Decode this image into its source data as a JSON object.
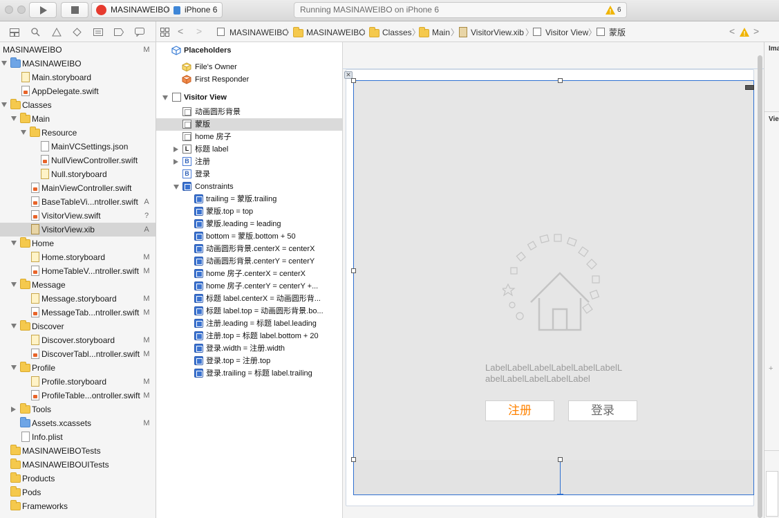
{
  "toolbar": {
    "scheme_name": "MASINAWEIBO",
    "device": "iPhone 6",
    "status_text": "Running MASINAWEIBO on iPhone 6",
    "warning_count": "6"
  },
  "navigator": {
    "project_name": "MASINAWEIBO",
    "project_badge": "M",
    "rows": [
      {
        "label": "MASINAWEIBO",
        "badge": ""
      },
      {
        "label": "Main.storyboard",
        "badge": ""
      },
      {
        "label": "AppDelegate.swift",
        "badge": ""
      },
      {
        "label": "Classes",
        "badge": ""
      },
      {
        "label": "Main",
        "badge": ""
      },
      {
        "label": "Resource",
        "badge": ""
      },
      {
        "label": "MainVCSettings.json",
        "badge": ""
      },
      {
        "label": "NullViewController.swift",
        "badge": ""
      },
      {
        "label": "Null.storyboard",
        "badge": ""
      },
      {
        "label": "MainViewController.swift",
        "badge": ""
      },
      {
        "label": "BaseTableVi...ntroller.swift",
        "badge": "A"
      },
      {
        "label": "VisitorView.swift",
        "badge": "?"
      },
      {
        "label": "VisitorView.xib",
        "badge": "A"
      },
      {
        "label": "Home",
        "badge": ""
      },
      {
        "label": "Home.storyboard",
        "badge": "M"
      },
      {
        "label": "HomeTableV...ntroller.swift",
        "badge": "M"
      },
      {
        "label": "Message",
        "badge": ""
      },
      {
        "label": "Message.storyboard",
        "badge": "M"
      },
      {
        "label": "MessageTab...ntroller.swift",
        "badge": "M"
      },
      {
        "label": "Discover",
        "badge": ""
      },
      {
        "label": "Discover.storyboard",
        "badge": "M"
      },
      {
        "label": "DiscoverTabl...ntroller.swift",
        "badge": "M"
      },
      {
        "label": "Profile",
        "badge": ""
      },
      {
        "label": "Profile.storyboard",
        "badge": "M"
      },
      {
        "label": "ProfileTable...ontroller.swift",
        "badge": "M"
      },
      {
        "label": "Tools",
        "badge": ""
      },
      {
        "label": "Assets.xcassets",
        "badge": "M"
      },
      {
        "label": "Info.plist",
        "badge": ""
      },
      {
        "label": "MASINAWEIBOTests",
        "badge": ""
      },
      {
        "label": "MASINAWEIBOUITests",
        "badge": ""
      },
      {
        "label": "Products",
        "badge": ""
      },
      {
        "label": "Pods",
        "badge": ""
      },
      {
        "label": "Frameworks",
        "badge": ""
      }
    ]
  },
  "jumpbar": {
    "crumbs": [
      "MASINAWEIBO",
      "MASINAWEIBO",
      "Classes",
      "Main",
      "VisitorView.xib",
      "Visitor View",
      "蒙版"
    ]
  },
  "outline": {
    "placeholders_title": "Placeholders",
    "files_owner": "File's Owner",
    "first_responder": "First Responder",
    "visitor_view": "Visitor View",
    "items": [
      "动画圆形背景",
      "蒙版",
      "home 房子",
      "标题 label",
      "注册",
      "登录",
      "Constraints"
    ],
    "constraints": [
      "trailing = 蒙版.trailing",
      "蒙版.top = top",
      "蒙版.leading = leading",
      "bottom = 蒙版.bottom + 50",
      "动画圆形背景.centerX = centerX",
      "动画圆形背景.centerY = centerY",
      "home 房子.centerX = centerX",
      "home 房子.centerY = centerY +...",
      "标题 label.centerX = 动画圆形背...",
      "标题 label.top = 动画圆形背景.bo...",
      "注册.leading = 标题 label.leading",
      "注册.top = 标题 label.bottom + 20",
      "登录.width = 注册.width",
      "登录.top = 注册.top",
      "登录.trailing = 标题 label.trailing"
    ]
  },
  "canvas": {
    "label_line1": "LabelLabelLabelLabelLabelLabelL",
    "label_line2": "abelLabelLabelLabelLabel",
    "register_button": "注册",
    "login_button": "登录"
  },
  "inspector": {
    "header1": "Ima",
    "header2": "Vie"
  },
  "colors": {
    "accent": "#2e6fd0",
    "register_text": "#ff8200",
    "login_text": "#6b6b6b",
    "warning": "#f0b400"
  }
}
